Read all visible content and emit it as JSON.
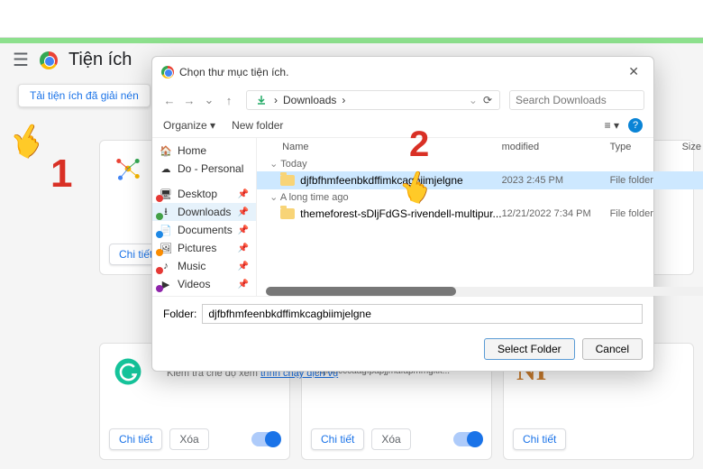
{
  "page": {
    "title": "Tiện ích",
    "unpack_button": "Tải tiện ích đã giải nén"
  },
  "annotations": {
    "one": "1",
    "two": "2"
  },
  "cards": {
    "detail": "Chi tiết",
    "remove": "Xóa",
    "service_prefix": "Kiểm tra chế độ xem ",
    "service_link": "trình chạy dịch vụ",
    "id_prefix": "Mã nhận dạng: bcjindcccaagfpapjjmafapmmgkk..."
  },
  "dialog": {
    "title": "Chọn thư mục tiện ích.",
    "breadcrumb": "Downloads",
    "breadcrumb_sep": "›",
    "search_placeholder": "Search Downloads",
    "organize": "Organize ▾",
    "new_folder": "New folder",
    "sidebar": [
      {
        "label": "Home",
        "icon": "🏠"
      },
      {
        "label": "Do - Personal",
        "icon": "☁"
      },
      {
        "label": "Desktop",
        "icon": "🖥"
      },
      {
        "label": "Downloads",
        "icon": "⭳",
        "selected": true
      },
      {
        "label": "Documents",
        "icon": "📄"
      },
      {
        "label": "Pictures",
        "icon": "🖼"
      },
      {
        "label": "Music",
        "icon": "♪"
      },
      {
        "label": "Videos",
        "icon": "▶"
      }
    ],
    "columns": {
      "name": "Name",
      "date": "modified",
      "type": "Type",
      "size": "Size"
    },
    "groups": [
      {
        "label": "Today",
        "rows": [
          {
            "name": "djfbfhmfeenbkdffimkcagbiimjelgne",
            "date": "2023 2:45 PM",
            "type": "File folder",
            "selected": true
          }
        ]
      },
      {
        "label": "A long time ago",
        "rows": [
          {
            "name": "themeforest-sDljFdGS-rivendell-multipur...",
            "date": "12/21/2022 7:34 PM",
            "type": "File folder"
          }
        ]
      }
    ],
    "folder_label": "Folder:",
    "folder_value": "djfbfhmfeenbkdffimkcagbiimjelgne",
    "select": "Select Folder",
    "cancel": "Cancel"
  }
}
